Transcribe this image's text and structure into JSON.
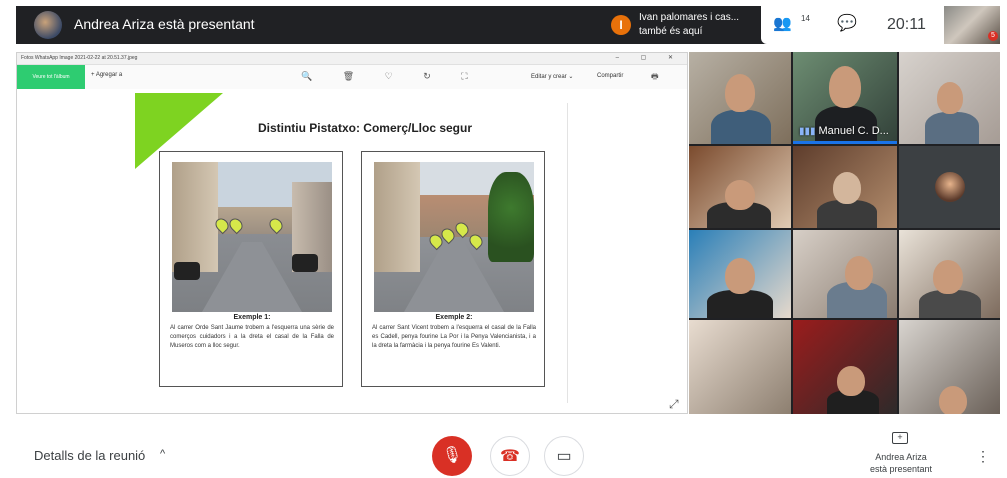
{
  "topbar": {
    "title": "Andrea Ariza està presentant",
    "notification": {
      "badge": "I",
      "line1": "Ivan palomares i cas...",
      "line2": "també és aquí"
    },
    "people_count": "14",
    "people_icon": "people-icon",
    "chat_icon": "chat-icon",
    "clock": "20:11",
    "self_badge": "5"
  },
  "shared_screen": {
    "app_title": "Fotos WhatsApp Image 2021-02-22 at 20.51.37.jpeg",
    "window_controls": "– ▢ ✕",
    "see_all_label": "Veure tot l'àlbum",
    "add_label": "+ Agregar a",
    "tool_icons": "🔍 🗑 ♡ ↻ ⛶",
    "edit_label": "Editar y crear ⌄",
    "share_label": "Compartir",
    "print_icon": "🖶",
    "slide": {
      "title": "Distintiu Pistatxo: Comerç/Lloc segur",
      "card1": {
        "heading": "Exemple 1:",
        "body": "Al carrer Orde Sant Jaume trobem a l'esquerra una sèrie de comerços cuidadors i a la dreta el casal de la Falla de Museros com a lloc segur."
      },
      "card2": {
        "heading": "Exemple 2:",
        "body": "Al carrer Sant Vicent trobem a l'esquerra el casal de la Falla es Cadell, penya fourine La Por i la Penya Valencianista, i a la dreta la farmàcia i la penya fourine Es Valenti."
      }
    }
  },
  "participants": {
    "active_speaker_name": "Manuel C. D...",
    "speaking_icon": "speaking-indicator-icon"
  },
  "bottombar": {
    "details_label": "Detalls de la reunió",
    "details_chevron": "^",
    "mic_icon": "mic-off-icon",
    "hangup_icon": "hangup-icon",
    "camera_icon": "camera-icon",
    "present_line1": "Andrea Ariza",
    "present_line2": "està presentant",
    "more_icon": "more-vert-icon"
  },
  "colors": {
    "top_bar": "#202124",
    "mic_red": "#d93025",
    "slide_green": "#7ed321",
    "pin_yellow": "#d6e84a"
  }
}
